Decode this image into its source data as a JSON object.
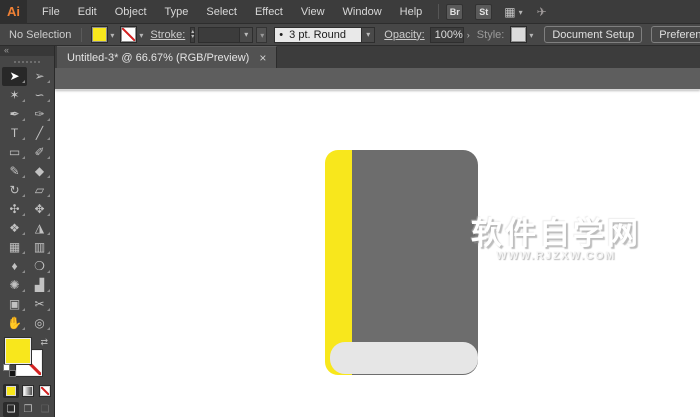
{
  "menubar": {
    "logo": "Ai",
    "menus": [
      "File",
      "Edit",
      "Object",
      "Type",
      "Select",
      "Effect",
      "View",
      "Window",
      "Help"
    ],
    "br_button": "Br",
    "st_button": "St"
  },
  "controlbar": {
    "selection_status": "No Selection",
    "stroke_label": "Stroke:",
    "brush_bullet": "•",
    "brush_value": "3 pt. Round",
    "opacity_label": "Opacity:",
    "opacity_value": "100%",
    "opacity_expander": "›",
    "style_label": "Style:",
    "document_setup_label": "Document Setup",
    "preferences_label": "Preferences"
  },
  "tabbar": {
    "tab_title": "Untitled-3* @ 66.67% (RGB/Preview)",
    "close_glyph": "×"
  },
  "tools": {
    "collapse_glyph": "«",
    "items": [
      {
        "name": "selection-tool",
        "glyph": "➤",
        "active": true
      },
      {
        "name": "direct-selection-tool",
        "glyph": "➢",
        "active": false
      },
      {
        "name": "magic-wand-tool",
        "glyph": "✶",
        "active": false
      },
      {
        "name": "lasso-tool",
        "glyph": "∽",
        "active": false
      },
      {
        "name": "pen-tool",
        "glyph": "✒",
        "active": false
      },
      {
        "name": "brush-pen-tool",
        "glyph": "✑",
        "active": false
      },
      {
        "name": "type-tool",
        "glyph": "T",
        "active": false
      },
      {
        "name": "line-segment-tool",
        "glyph": "╱",
        "active": false
      },
      {
        "name": "rectangle-tool",
        "glyph": "▭",
        "active": false
      },
      {
        "name": "paintbrush-tool",
        "glyph": "✐",
        "active": false
      },
      {
        "name": "pencil-tool",
        "glyph": "✎",
        "active": false
      },
      {
        "name": "eraser-tool",
        "glyph": "◆",
        "active": false
      },
      {
        "name": "rotate-tool",
        "glyph": "↻",
        "active": false
      },
      {
        "name": "scale-tool",
        "glyph": "▱",
        "active": false
      },
      {
        "name": "width-tool",
        "glyph": "✣",
        "active": false
      },
      {
        "name": "free-transform-tool",
        "glyph": "✥",
        "active": false
      },
      {
        "name": "shape-builder-tool",
        "glyph": "❖",
        "active": false
      },
      {
        "name": "perspective-grid-tool",
        "glyph": "◮",
        "active": false
      },
      {
        "name": "mesh-tool",
        "glyph": "▦",
        "active": false
      },
      {
        "name": "gradient-tool",
        "glyph": "▥",
        "active": false
      },
      {
        "name": "eyedropper-tool",
        "glyph": "♦",
        "active": false
      },
      {
        "name": "blend-tool",
        "glyph": "❍",
        "active": false
      },
      {
        "name": "symbol-sprayer-tool",
        "glyph": "✺",
        "active": false
      },
      {
        "name": "column-graph-tool",
        "glyph": "▟",
        "active": false
      },
      {
        "name": "artboard-tool",
        "glyph": "▣",
        "active": false
      },
      {
        "name": "slice-tool",
        "glyph": "✂",
        "active": false
      },
      {
        "name": "hand-tool",
        "glyph": "✋",
        "active": false
      },
      {
        "name": "zoom-tool",
        "glyph": "◎",
        "active": false
      }
    ]
  },
  "canvas": {
    "watermark_title": "软件自学网",
    "watermark_url": "WWW.RJZXW.COM",
    "book": {
      "spine_color": "#f8e71c",
      "cover_color": "#6d6d6d",
      "band_color": "#e6e6e6"
    }
  },
  "colors": {
    "fill_color": "#f8e71c",
    "logo_orange": "#f08135"
  }
}
